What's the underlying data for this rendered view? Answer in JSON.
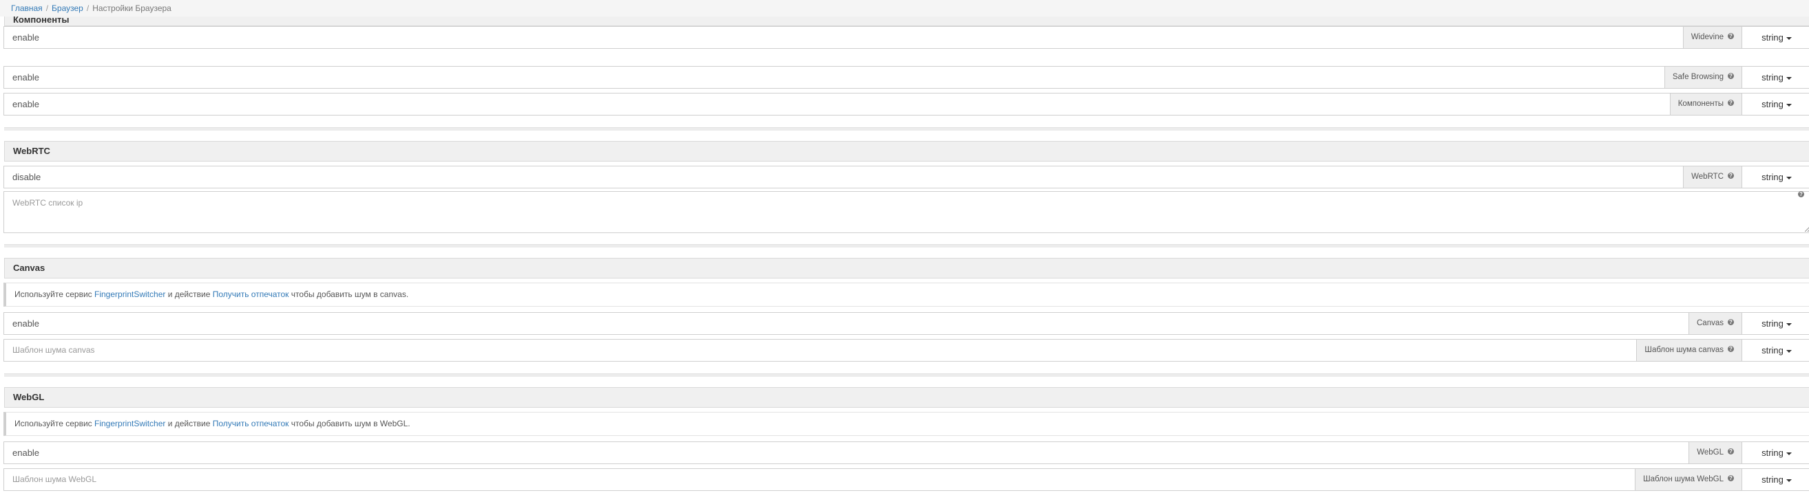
{
  "breadcrumb": {
    "home": "Главная",
    "browser": "Браузер",
    "current": "Настройки Браузера",
    "separator": "/"
  },
  "sections": {
    "components": {
      "title": "Компоненты",
      "rows": [
        {
          "value": "enable",
          "label": "Widevine",
          "type": "string"
        },
        {
          "value": "enable",
          "label": "Safe Browsing",
          "type": "string"
        },
        {
          "value": "enable",
          "label": "Компоненты",
          "type": "string"
        }
      ]
    },
    "webrtc": {
      "title": "WebRTC",
      "row": {
        "value": "disable",
        "label": "WebRTC",
        "type": "string"
      },
      "ip_list_placeholder": "WebRTC список ip"
    },
    "canvas": {
      "title": "Canvas",
      "note": {
        "prefix": "Используйте сервис",
        "service_link": "FingerprintSwitcher",
        "middle": "и действие",
        "action_link": "Получить отпечаток",
        "suffix": "чтобы добавить шум в canvas."
      },
      "row": {
        "value": "enable",
        "label": "Canvas",
        "type": "string"
      },
      "noise_row": {
        "placeholder": "Шаблон шума canvas",
        "label": "Шаблон шума canvas",
        "type": "string"
      }
    },
    "webgl": {
      "title": "WebGL",
      "note": {
        "prefix": "Используйте сервис",
        "service_link": "FingerprintSwitcher",
        "middle": "и действие",
        "action_link": "Получить отпечаток",
        "suffix": "чтобы добавить шум в WebGL."
      },
      "row": {
        "value": "enable",
        "label": "WebGL",
        "type": "string"
      },
      "noise_row": {
        "placeholder": "Шаблон шума WebGL",
        "label": "Шаблон шума WebGL",
        "type": "string"
      }
    }
  },
  "icons": {
    "help": "question-circle-icon",
    "caret": "caret-down-icon",
    "resize": "resize-handle-icon"
  }
}
